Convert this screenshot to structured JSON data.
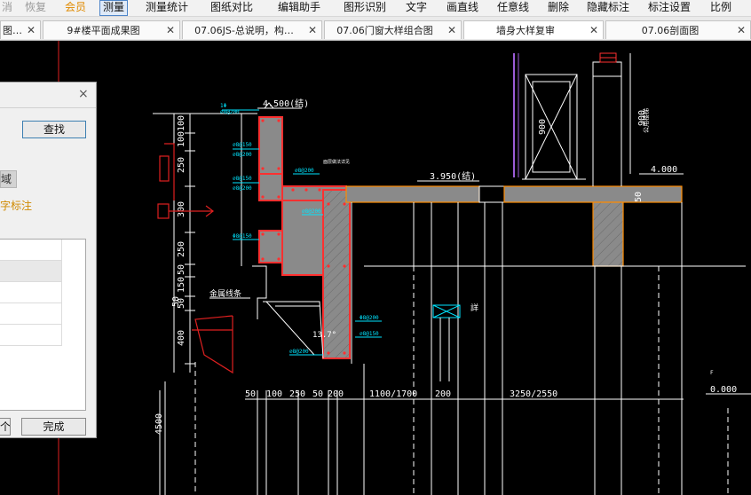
{
  "menubar": {
    "items": [
      {
        "label": "消",
        "style": "dim"
      },
      {
        "label": "恢复",
        "style": "dim"
      },
      {
        "label": "会员",
        "style": "member"
      },
      {
        "label": "测量",
        "style": "active"
      },
      {
        "label": "测量统计",
        "style": "normal"
      },
      {
        "label": "图纸对比",
        "style": "normal"
      },
      {
        "label": "编辑助手",
        "style": "normal"
      },
      {
        "label": "图形识别",
        "style": "normal"
      },
      {
        "label": "文字",
        "style": "normal"
      },
      {
        "label": "画直线",
        "style": "normal"
      },
      {
        "label": "任意线",
        "style": "normal"
      },
      {
        "label": "删除",
        "style": "normal"
      },
      {
        "label": "隐藏标注",
        "style": "normal"
      },
      {
        "label": "标注设置",
        "style": "normal"
      },
      {
        "label": "比例",
        "style": "normal"
      }
    ]
  },
  "tabs": [
    {
      "label": "图…",
      "close": "✕"
    },
    {
      "label": "9#楼平面成果图",
      "close": "✕"
    },
    {
      "label": "07.06JS-总说明，构…",
      "close": "✕"
    },
    {
      "label": "07.06门窗大样组合图",
      "close": "✕"
    },
    {
      "label": "墙身大样复审",
      "close": "✕"
    },
    {
      "label": "07.06剖面图",
      "close": "✕"
    }
  ],
  "dialog": {
    "close_glyph": "×",
    "find_button": "查找",
    "area_label": "域",
    "text_note_label": "字标注",
    "prev_button": "个",
    "done_button": "完成"
  },
  "drawing": {
    "colors": {
      "background": "#000000",
      "line": "#ffffff",
      "rebar": "#ff3030",
      "dim_red": "#e02020",
      "annotation": "#00e5ff",
      "concrete": "#8a8a8a",
      "floor_edge": "#ff8c00",
      "purple": "#9b5cd6"
    },
    "elevations": {
      "top": "4.500(结)",
      "mid": "3.950(结)",
      "right": "4.000",
      "ground": "0.000"
    },
    "dims_vertical_left": [
      "100",
      "100",
      "250",
      "300",
      "250",
      "50",
      "150",
      "50",
      "400"
    ],
    "dims_vertical_small": [
      "50",
      "4500"
    ],
    "dims_bottom": [
      "50",
      "100",
      "250",
      "50",
      "200",
      "1100/1700",
      "200",
      "3250/2550"
    ],
    "right_dims": [
      "900",
      "900",
      "50"
    ],
    "labels": {
      "metal_panel": "金属线条",
      "room_label": "公用楼梯",
      "slab_note": "面层做法详见",
      "window_mark": "詳",
      "angle_mark": "13.7°"
    },
    "rebar_marks": [
      "1Φ",
      "⌀8@200",
      "⌀8@150",
      "⌀8@200",
      "⌀8@150",
      "⌀8@200",
      "Φ8@150",
      "⌀8@200",
      "⌀8@200",
      "Φ8@200",
      "⌀8@150",
      "⌀8@200"
    ]
  }
}
